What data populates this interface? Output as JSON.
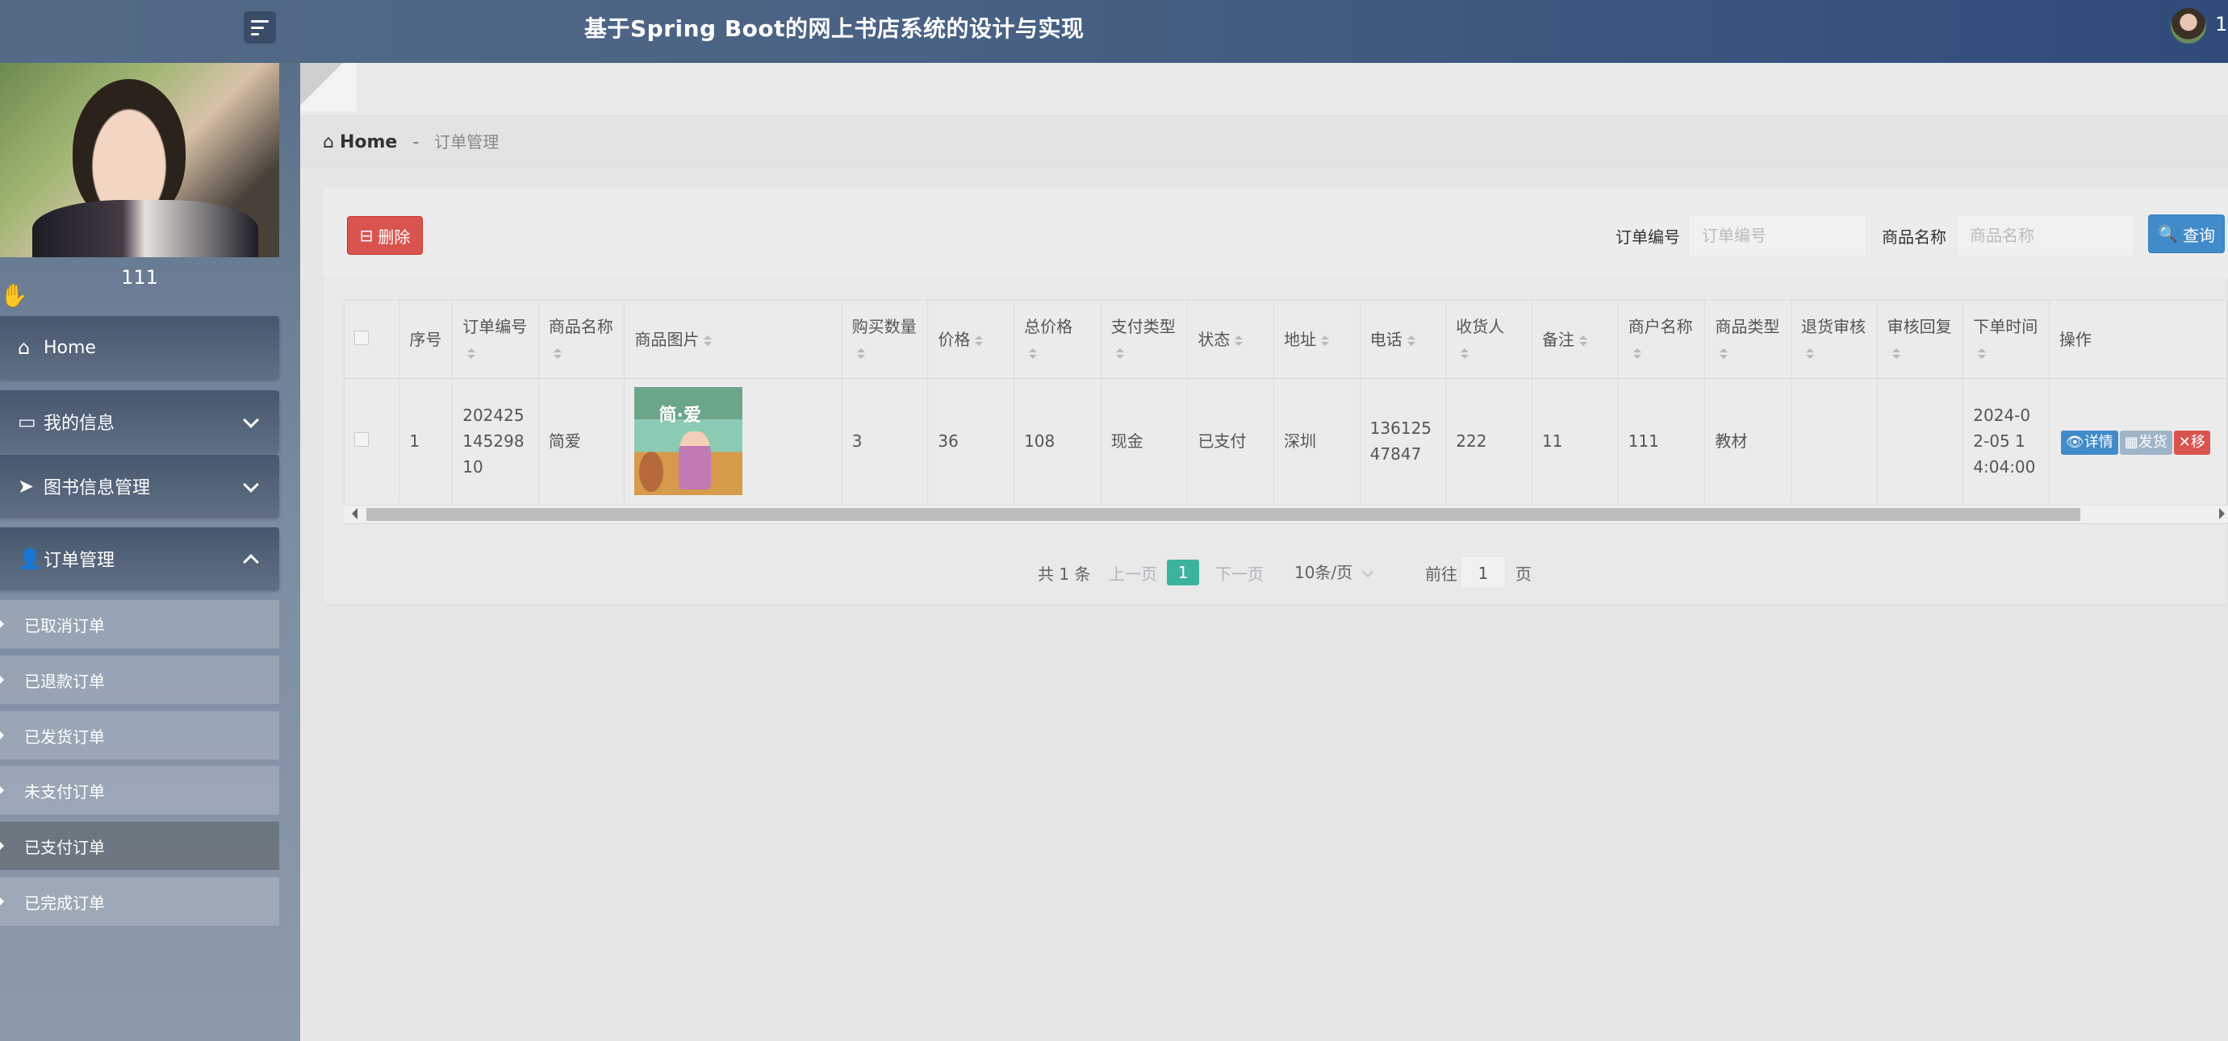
{
  "header": {
    "title": "基于Spring Boot的网上书店系统的设计与实现",
    "user_label": "1"
  },
  "sidebar": {
    "profile_name": "111",
    "items": [
      {
        "label": "Home",
        "icon": "home-icon"
      },
      {
        "label": "我的信息",
        "icon": "id-card-icon"
      },
      {
        "label": "图书信息管理",
        "icon": "paper-plane-icon"
      },
      {
        "label": "订单管理",
        "icon": "user-icon"
      }
    ],
    "sub_items": [
      {
        "label": "已取消订单"
      },
      {
        "label": "已退款订单"
      },
      {
        "label": "已发货订单"
      },
      {
        "label": "未支付订单"
      },
      {
        "label": "已支付订单"
      },
      {
        "label": "已完成订单"
      }
    ]
  },
  "breadcrumb": {
    "home": "Home",
    "separator": "-",
    "current": "订单管理"
  },
  "toolbar": {
    "delete_label": "删除",
    "order_no_label": "订单编号",
    "order_no_placeholder": "订单编号",
    "product_name_label": "商品名称",
    "product_name_placeholder": "商品名称",
    "query_label": "查询"
  },
  "table": {
    "headers": [
      "序号",
      "订单编号",
      "商品名称",
      "商品图片",
      "购买数量",
      "价格",
      "总价格",
      "支付类型",
      "状态",
      "地址",
      "电话",
      "收货人",
      "备注",
      "商户名称",
      "商品类型",
      "退货审核",
      "审核回复",
      "下单时间",
      "操作"
    ],
    "rows": [
      {
        "index": "1",
        "order_no": "20242514529810",
        "product_name": "简爱",
        "image_title": "简·爱",
        "quantity": "3",
        "price": "36",
        "total": "108",
        "pay_type": "现金",
        "status": "已支付",
        "address": "深圳",
        "phone": "13612547847",
        "receiver": "222",
        "remark": "11",
        "merchant": "111",
        "product_type": "教材",
        "return_review": "",
        "review_reply": "",
        "order_time": "2024-02-05 14:04:00",
        "actions": {
          "detail": "详情",
          "ship": "发货",
          "remove": "移"
        }
      }
    ]
  },
  "pagination": {
    "total": "共 1 条",
    "prev": "上一页",
    "current_page": "1",
    "next": "下一页",
    "page_size": "10条/页",
    "goto_label": "前往",
    "goto_value": "1",
    "page_suffix": "页"
  }
}
